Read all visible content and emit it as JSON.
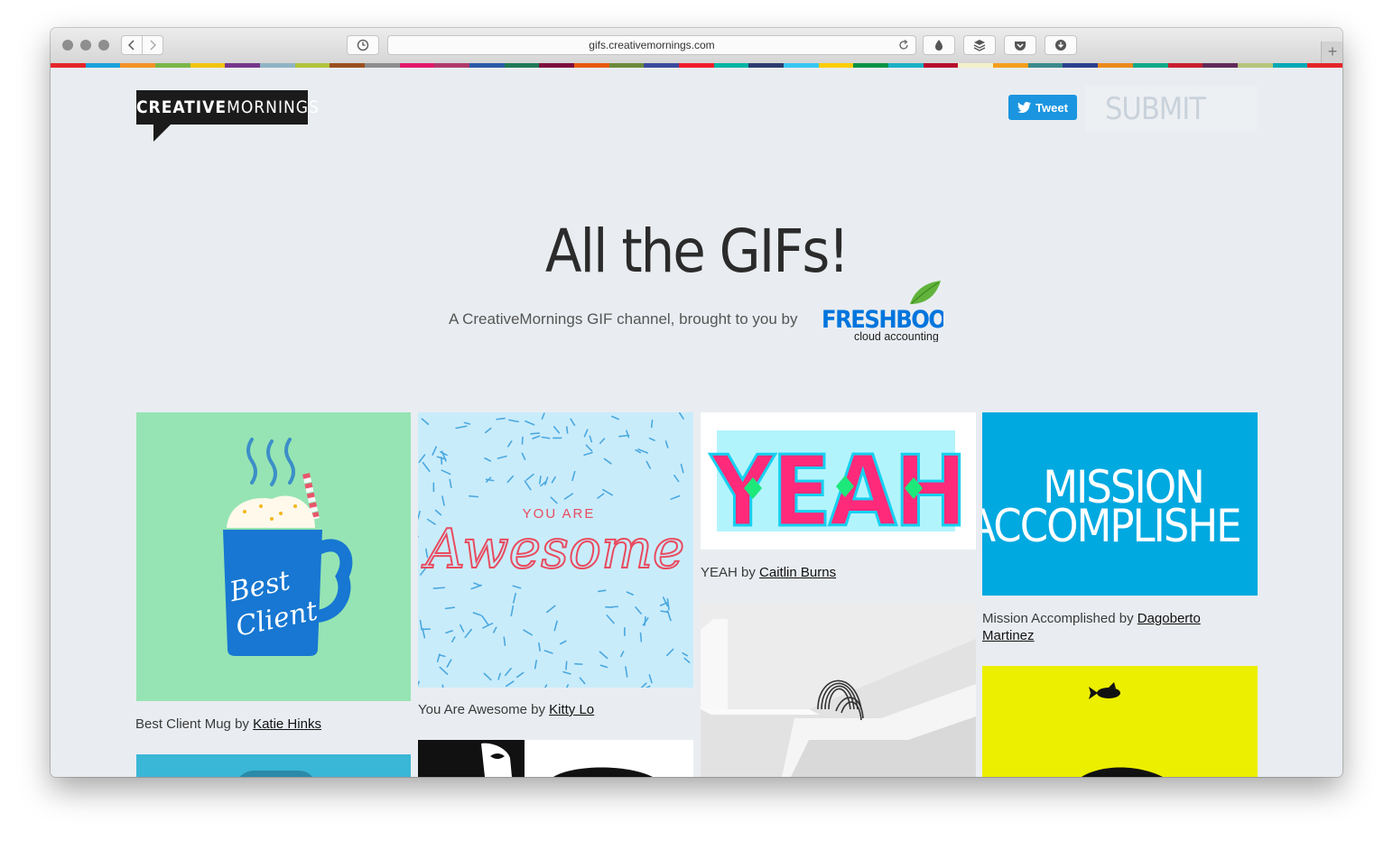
{
  "browser": {
    "url": "gifs.creativemornings.com",
    "new_tab_label": "+"
  },
  "header": {
    "logo_bold": "CREATIVE",
    "logo_light": "MORNINGS",
    "tweet_label": "Tweet",
    "submit_label": "SUBMIT"
  },
  "hero": {
    "title": "All the GIFs!",
    "subtitle": "A CreativeMornings GIF channel, brought to you by",
    "sponsor_name": "FRESHBOOKS",
    "sponsor_tagline": "cloud accounting"
  },
  "gifs": [
    {
      "title": "Best Client Mug",
      "by": "by",
      "author": "Katie Hinks",
      "bg": "#96e4b3",
      "art_text_1": "Best",
      "art_text_2": "Client"
    },
    {
      "title": "You Are Awesome",
      "by": "by",
      "author": "Kitty Lo",
      "bg": "#c9ecfb",
      "art_text_1": "YOU ARE",
      "art_text_2": "Awesome"
    },
    {
      "title": "YEAH",
      "by": "by",
      "author": "Caitlin Burns",
      "bg": "#ffffff",
      "art_text_1": "YEAH"
    },
    {
      "title": "Mission Accomplished",
      "by": "by",
      "author_line1": "Dagoberto",
      "author_line2": "Martinez",
      "bg": "#00a9e0",
      "art_text_1": "MISSION",
      "art_text_2": "ACCOMPLISHE"
    }
  ],
  "colors": {
    "stripe": [
      "#e42528",
      "#1aa1db",
      "#f39325",
      "#7ab648",
      "#f1c40f",
      "#76378b",
      "#8fb3c4",
      "#b1c43b",
      "#9b4f1f",
      "#8d8d8d",
      "#e2196b",
      "#b03a6b",
      "#2a5aa9",
      "#1f7a56",
      "#7e0e3e",
      "#e8590c",
      "#6c8a3b",
      "#3c4a9d",
      "#f01c2d",
      "#00b3a4",
      "#2d3b70",
      "#37c6f2",
      "#ffcc00",
      "#0a9245",
      "#1bb0c4",
      "#b70e2f",
      "#f3f1ca",
      "#f59e1d",
      "#3b8a8a",
      "#2c3f8e",
      "#ec8a1b",
      "#0fa98a",
      "#c81f2f",
      "#622a58",
      "#b5c67b",
      "#00a8b5",
      "#e42528"
    ],
    "page_bg": "#e9edf1",
    "tweet_blue": "#1b95e0"
  }
}
